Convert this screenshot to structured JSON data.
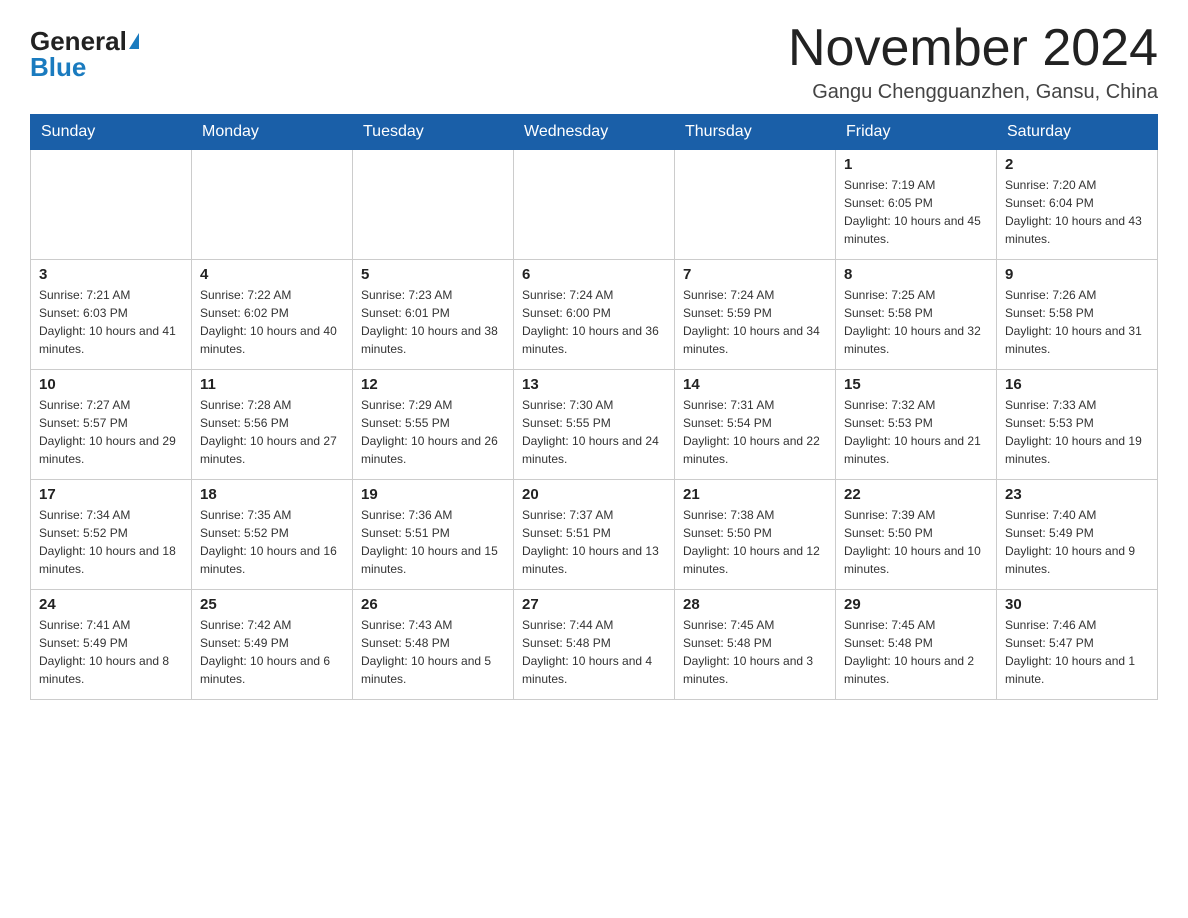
{
  "header": {
    "logo_general": "General",
    "logo_blue": "Blue",
    "month_title": "November 2024",
    "location": "Gangu Chengguanzhen, Gansu, China"
  },
  "weekdays": [
    "Sunday",
    "Monday",
    "Tuesday",
    "Wednesday",
    "Thursday",
    "Friday",
    "Saturday"
  ],
  "weeks": [
    {
      "days": [
        {
          "num": "",
          "info": ""
        },
        {
          "num": "",
          "info": ""
        },
        {
          "num": "",
          "info": ""
        },
        {
          "num": "",
          "info": ""
        },
        {
          "num": "",
          "info": ""
        },
        {
          "num": "1",
          "info": "Sunrise: 7:19 AM\nSunset: 6:05 PM\nDaylight: 10 hours and 45 minutes."
        },
        {
          "num": "2",
          "info": "Sunrise: 7:20 AM\nSunset: 6:04 PM\nDaylight: 10 hours and 43 minutes."
        }
      ]
    },
    {
      "days": [
        {
          "num": "3",
          "info": "Sunrise: 7:21 AM\nSunset: 6:03 PM\nDaylight: 10 hours and 41 minutes."
        },
        {
          "num": "4",
          "info": "Sunrise: 7:22 AM\nSunset: 6:02 PM\nDaylight: 10 hours and 40 minutes."
        },
        {
          "num": "5",
          "info": "Sunrise: 7:23 AM\nSunset: 6:01 PM\nDaylight: 10 hours and 38 minutes."
        },
        {
          "num": "6",
          "info": "Sunrise: 7:24 AM\nSunset: 6:00 PM\nDaylight: 10 hours and 36 minutes."
        },
        {
          "num": "7",
          "info": "Sunrise: 7:24 AM\nSunset: 5:59 PM\nDaylight: 10 hours and 34 minutes."
        },
        {
          "num": "8",
          "info": "Sunrise: 7:25 AM\nSunset: 5:58 PM\nDaylight: 10 hours and 32 minutes."
        },
        {
          "num": "9",
          "info": "Sunrise: 7:26 AM\nSunset: 5:58 PM\nDaylight: 10 hours and 31 minutes."
        }
      ]
    },
    {
      "days": [
        {
          "num": "10",
          "info": "Sunrise: 7:27 AM\nSunset: 5:57 PM\nDaylight: 10 hours and 29 minutes."
        },
        {
          "num": "11",
          "info": "Sunrise: 7:28 AM\nSunset: 5:56 PM\nDaylight: 10 hours and 27 minutes."
        },
        {
          "num": "12",
          "info": "Sunrise: 7:29 AM\nSunset: 5:55 PM\nDaylight: 10 hours and 26 minutes."
        },
        {
          "num": "13",
          "info": "Sunrise: 7:30 AM\nSunset: 5:55 PM\nDaylight: 10 hours and 24 minutes."
        },
        {
          "num": "14",
          "info": "Sunrise: 7:31 AM\nSunset: 5:54 PM\nDaylight: 10 hours and 22 minutes."
        },
        {
          "num": "15",
          "info": "Sunrise: 7:32 AM\nSunset: 5:53 PM\nDaylight: 10 hours and 21 minutes."
        },
        {
          "num": "16",
          "info": "Sunrise: 7:33 AM\nSunset: 5:53 PM\nDaylight: 10 hours and 19 minutes."
        }
      ]
    },
    {
      "days": [
        {
          "num": "17",
          "info": "Sunrise: 7:34 AM\nSunset: 5:52 PM\nDaylight: 10 hours and 18 minutes."
        },
        {
          "num": "18",
          "info": "Sunrise: 7:35 AM\nSunset: 5:52 PM\nDaylight: 10 hours and 16 minutes."
        },
        {
          "num": "19",
          "info": "Sunrise: 7:36 AM\nSunset: 5:51 PM\nDaylight: 10 hours and 15 minutes."
        },
        {
          "num": "20",
          "info": "Sunrise: 7:37 AM\nSunset: 5:51 PM\nDaylight: 10 hours and 13 minutes."
        },
        {
          "num": "21",
          "info": "Sunrise: 7:38 AM\nSunset: 5:50 PM\nDaylight: 10 hours and 12 minutes."
        },
        {
          "num": "22",
          "info": "Sunrise: 7:39 AM\nSunset: 5:50 PM\nDaylight: 10 hours and 10 minutes."
        },
        {
          "num": "23",
          "info": "Sunrise: 7:40 AM\nSunset: 5:49 PM\nDaylight: 10 hours and 9 minutes."
        }
      ]
    },
    {
      "days": [
        {
          "num": "24",
          "info": "Sunrise: 7:41 AM\nSunset: 5:49 PM\nDaylight: 10 hours and 8 minutes."
        },
        {
          "num": "25",
          "info": "Sunrise: 7:42 AM\nSunset: 5:49 PM\nDaylight: 10 hours and 6 minutes."
        },
        {
          "num": "26",
          "info": "Sunrise: 7:43 AM\nSunset: 5:48 PM\nDaylight: 10 hours and 5 minutes."
        },
        {
          "num": "27",
          "info": "Sunrise: 7:44 AM\nSunset: 5:48 PM\nDaylight: 10 hours and 4 minutes."
        },
        {
          "num": "28",
          "info": "Sunrise: 7:45 AM\nSunset: 5:48 PM\nDaylight: 10 hours and 3 minutes."
        },
        {
          "num": "29",
          "info": "Sunrise: 7:45 AM\nSunset: 5:48 PM\nDaylight: 10 hours and 2 minutes."
        },
        {
          "num": "30",
          "info": "Sunrise: 7:46 AM\nSunset: 5:47 PM\nDaylight: 10 hours and 1 minute."
        }
      ]
    }
  ]
}
